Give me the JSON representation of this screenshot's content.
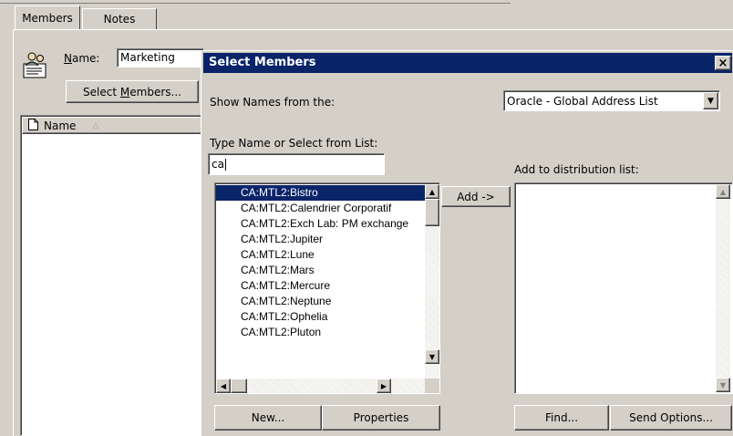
{
  "tabs": [
    {
      "label": "Members"
    },
    {
      "label": "Notes"
    }
  ],
  "group": {
    "name_label_prefix": "",
    "name_label_underlined": "N",
    "name_label_rest": "ame:",
    "name_value": "Marketing",
    "select_members_prefix": "Select ",
    "select_members_underlined": "M",
    "select_members_rest": "embers...",
    "column_name": "Name"
  },
  "dialog": {
    "title": "Select Members",
    "close_label": "×",
    "show_names_label": "Show Names from the:",
    "address_book": "Oracle - Global Address List",
    "type_name_label": "Type Name or Select from List:",
    "search_value": "ca",
    "add_button": "Add ->",
    "add_to_list_label": "Add to distribution list:",
    "names": [
      "CA:MTL2:Bistro",
      "CA:MTL2:Calendrier Corporatif",
      "CA:MTL2:Exch Lab: PM exchange",
      "CA:MTL2:Jupiter",
      "CA:MTL2:Lune",
      "CA:MTL2:Mars",
      "CA:MTL2:Mercure",
      "CA:MTL2:Neptune",
      "CA:MTL2:Ophelia",
      "CA:MTL2:Pluton"
    ],
    "selected_index": 0,
    "new_button": "New...",
    "properties_button": "Properties",
    "find_button": "Find...",
    "send_options_button": "Send Options..."
  },
  "colors": {
    "title_bar": "#0a246a",
    "selection": "#0a246a",
    "face": "#d4d0c8"
  }
}
